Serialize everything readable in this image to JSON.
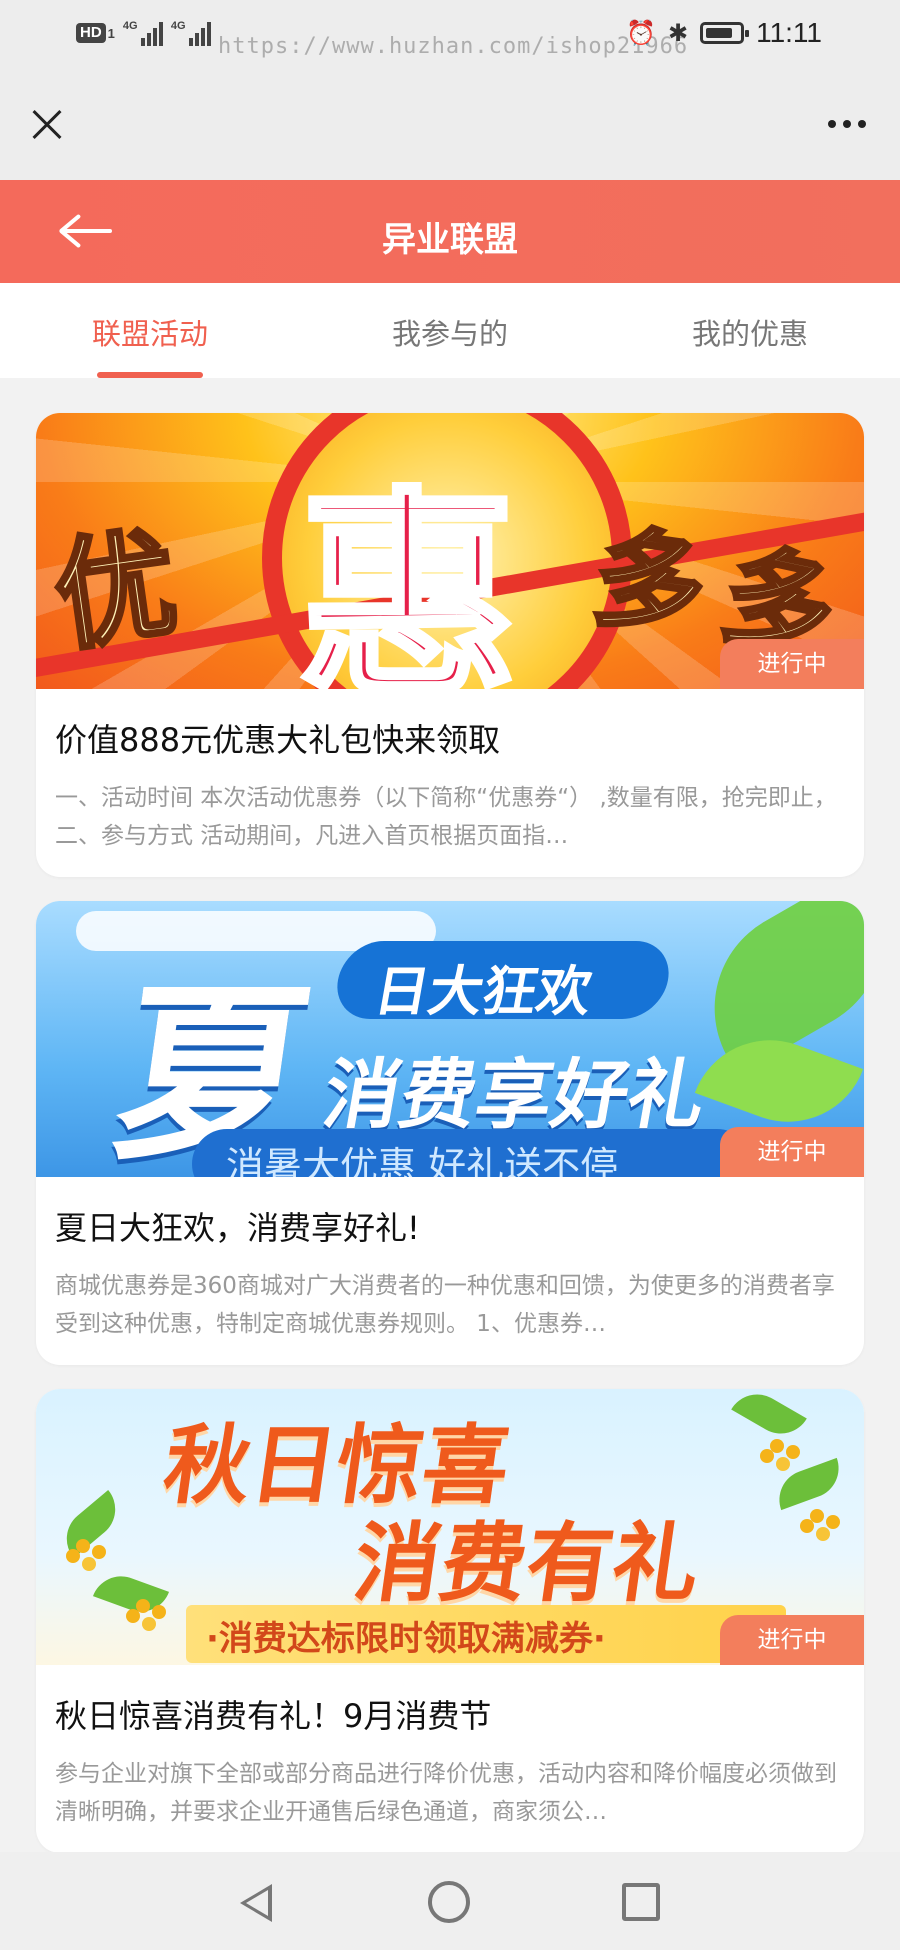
{
  "status_bar": {
    "hd": "HD",
    "hd_sub": "1",
    "net1": "4G",
    "net2": "4G",
    "watermark": "https://www.huzhan.com/ishop21966",
    "time": "11:11"
  },
  "header": {
    "title": "异业联盟"
  },
  "tabs": [
    {
      "label": "联盟活动",
      "active": true
    },
    {
      "label": "我参与的",
      "active": false
    },
    {
      "label": "我的优惠",
      "active": false
    }
  ],
  "cards": [
    {
      "banner_text": [
        "优",
        "惠",
        "多",
        "多"
      ],
      "status": "进行中",
      "title": "价值888元优惠大礼包快来领取",
      "desc": "一、活动时间 本次活动优惠券（以下简称“优惠券“） ,数量有限，抢完即止， 二、参与方式    活动期间，凡进入首页根据页面指…"
    },
    {
      "banner_text": [
        "夏",
        "日大狂欢",
        "消费享好礼",
        "消暑大优惠  好礼送不停"
      ],
      "status": "进行中",
      "title": "夏日大狂欢，消费享好礼!",
      "desc": "商城优惠券是360商城对广大消费者的一种优惠和回馈，为使更多的消费者享受到这种优惠，特制定商城优惠券规则。 1、优惠券…"
    },
    {
      "banner_text": [
        "秋日惊喜",
        "消费有礼",
        "·消费达标限时领取满减券·"
      ],
      "status": "进行中",
      "title": "秋日惊喜消费有礼！9月消费节",
      "desc": "参与企业对旗下全部或部分商品进行降价优惠，活动内容和降价幅度必须做到清晰明确，并要求企业开通售后绿色通道，商家须公…"
    }
  ],
  "colors": {
    "accent": "#f0604f",
    "header_bg": "#f46a5b",
    "status_tag": "#f37e5c"
  }
}
